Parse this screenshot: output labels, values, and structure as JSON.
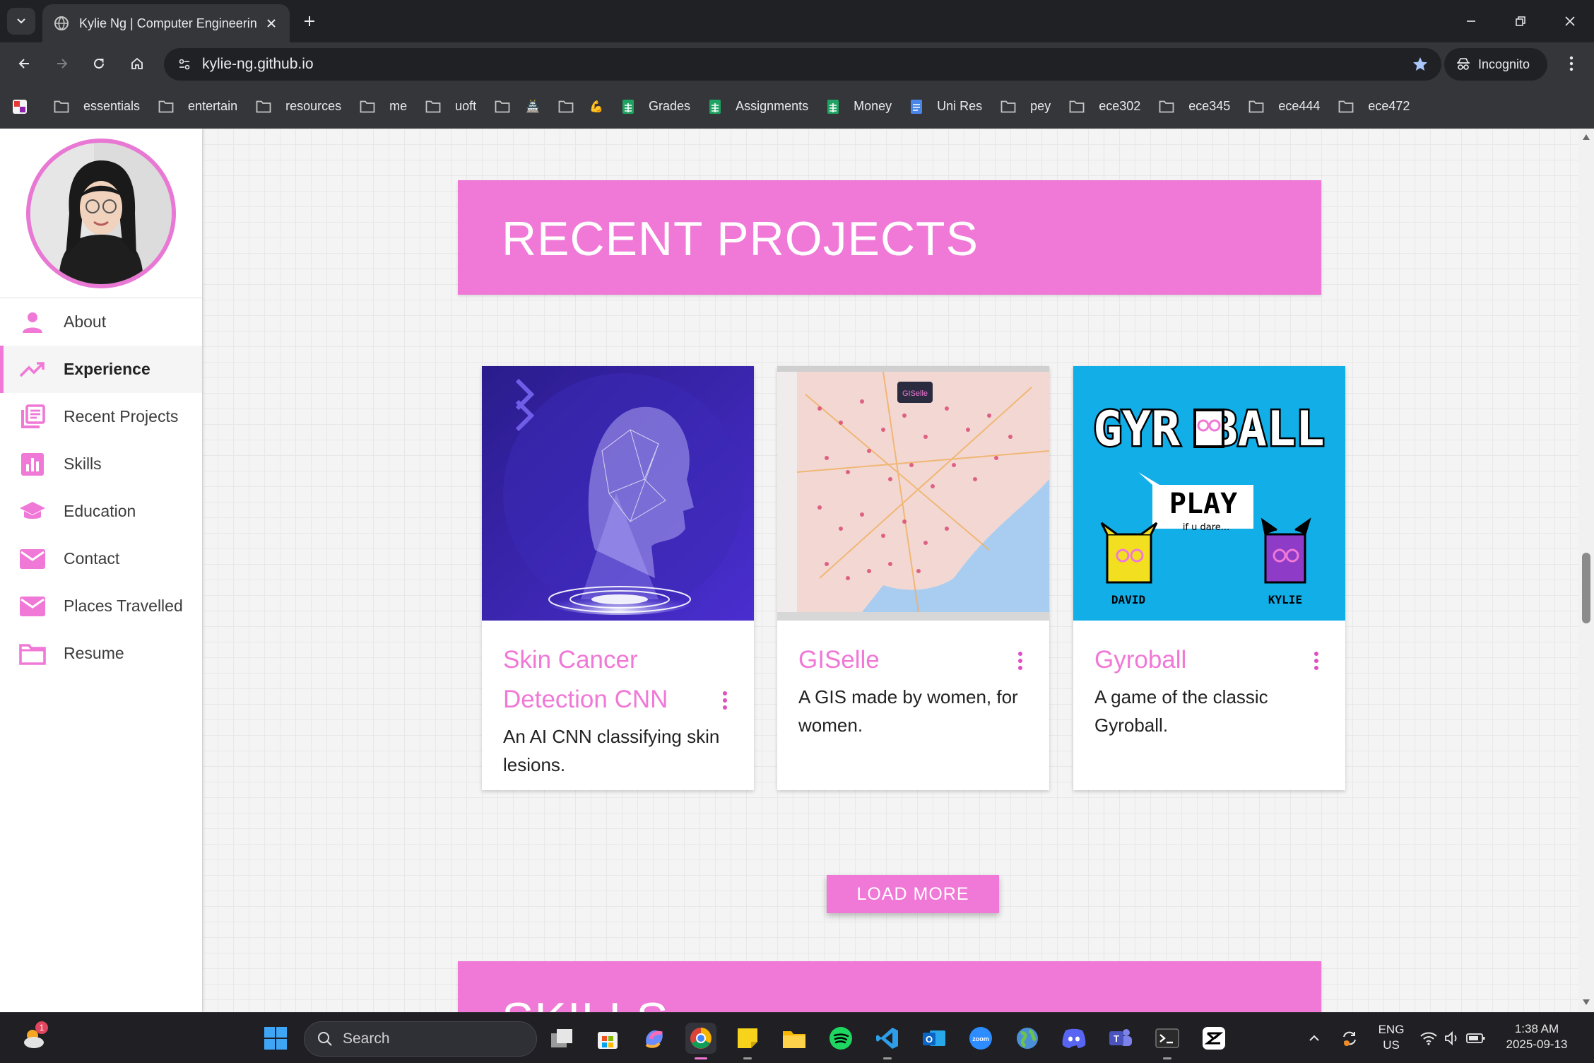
{
  "browser": {
    "tab_title": "Kylie Ng | Computer Engineering",
    "url": "kylie-ng.github.io",
    "incognito_label": "Incognito",
    "bookmarks": [
      {
        "type": "folder",
        "label": "essentials"
      },
      {
        "type": "folder",
        "label": "entertain"
      },
      {
        "type": "folder",
        "label": "resources"
      },
      {
        "type": "folder",
        "label": "me"
      },
      {
        "type": "folder",
        "label": "uoft"
      },
      {
        "type": "folder",
        "label": "",
        "emoji": "🏯"
      },
      {
        "type": "folder",
        "label": "",
        "emoji": "💪"
      },
      {
        "type": "sheet",
        "label": "Grades"
      },
      {
        "type": "sheet",
        "label": "Assignments"
      },
      {
        "type": "sheet",
        "label": "Money"
      },
      {
        "type": "doc",
        "label": "Uni Res"
      },
      {
        "type": "folder",
        "label": "pey"
      },
      {
        "type": "folder",
        "label": "ece302"
      },
      {
        "type": "folder",
        "label": "ece345"
      },
      {
        "type": "folder",
        "label": "ece444"
      },
      {
        "type": "folder",
        "label": "ece472"
      }
    ]
  },
  "sidebar": {
    "items": [
      {
        "label": "About",
        "icon": "person-icon"
      },
      {
        "label": "Experience",
        "icon": "trending-up-icon",
        "active": true
      },
      {
        "label": "Recent Projects",
        "icon": "library-books-icon"
      },
      {
        "label": "Skills",
        "icon": "bar-chart-icon"
      },
      {
        "label": "Education",
        "icon": "school-icon"
      },
      {
        "label": "Contact",
        "icon": "mail-icon"
      },
      {
        "label": "Places Travelled",
        "icon": "mail-icon"
      },
      {
        "label": "Resume",
        "icon": "folder-icon"
      }
    ]
  },
  "main": {
    "section_title": "RECENT PROJECTS",
    "next_section_title": "SKILLS",
    "projects": [
      {
        "title": "Skin Cancer Detection CNN",
        "description": "An AI CNN classifying skin lesions."
      },
      {
        "title": "GISelle",
        "description": "A GIS made by women, for women.",
        "badge": "GISelle"
      },
      {
        "title": "Gyroball",
        "description": "A game of the classic Gyroball.",
        "art_title": "GYR BALL",
        "art_play": "PLAY",
        "art_sub": "if u dare...",
        "art_left": "DAVID",
        "art_right": "KYLIE"
      }
    ],
    "load_more_label": "LOAD MORE"
  },
  "taskbar": {
    "search_placeholder": "Search",
    "weather_badge": "1",
    "lang_line1": "ENG",
    "lang_line2": "US",
    "time": "1:38 AM",
    "date": "2025-09-13"
  },
  "colors": {
    "accent_pink": "#f078d6",
    "chrome_dark": "#202124",
    "chrome_mid": "#35363a"
  }
}
